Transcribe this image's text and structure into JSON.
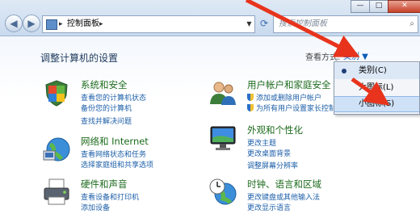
{
  "address_bar": {
    "path": "控制面板"
  },
  "search": {
    "placeholder": "搜索控制面板"
  },
  "window_buttons": {
    "minimize": "—",
    "maximize": "□",
    "close": "✕"
  },
  "header": {
    "title": "调整计算机的设置",
    "view_by_label": "查看方式:",
    "view_by_value": "类别 ▼"
  },
  "view_menu": {
    "items": [
      "类别(C)",
      "大图标(L)",
      "小图标(S)"
    ],
    "selected_index": 0
  },
  "categories": [
    {
      "title": "系统和安全",
      "links": [
        "查看您的计算机状态",
        "备份您的计算机",
        "查找并解决问题"
      ],
      "icon": "shield-flag-icon"
    },
    {
      "title": "网络和 Internet",
      "links": [
        "查看网络状态和任务",
        "选择家庭组和共享选项"
      ],
      "icon": "network-globe-icon"
    },
    {
      "title": "硬件和声音",
      "links": [
        "查看设备和打印机",
        "添加设备"
      ],
      "icon": "printer-icon"
    },
    {
      "title": "用户帐户和家庭安全",
      "links": [
        "添加或删除用户帐户",
        "为所有用户设置家长控制"
      ],
      "icon": "users-icon"
    },
    {
      "title": "外观和个性化",
      "links": [
        "更改主题",
        "更改桌面背景",
        "调整屏幕分辨率"
      ],
      "icon": "display-icon"
    },
    {
      "title": "时钟、语言和区域",
      "links": [
        "更改键盘或其他输入法",
        "更改显示语言"
      ],
      "icon": "clock-globe-icon"
    }
  ],
  "colors": {
    "category_title": "#1d6b1d",
    "link": "#1d5fa8",
    "annotation_arrow": "#e8341c"
  }
}
